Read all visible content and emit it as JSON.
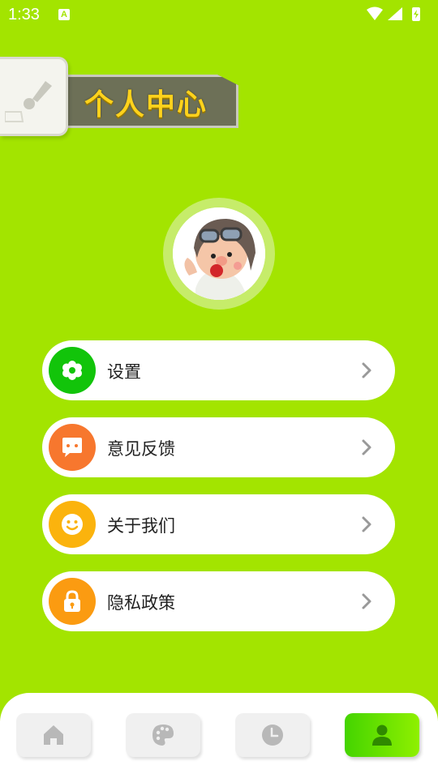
{
  "status_bar": {
    "time": "1:33",
    "notification_letter": "A"
  },
  "header": {
    "title": "个人中心"
  },
  "menu": {
    "items": [
      {
        "label": "设置",
        "icon": "gear-icon",
        "color": "#12c40a"
      },
      {
        "label": "意见反馈",
        "icon": "chat-bubble-icon",
        "color": "#f7772e"
      },
      {
        "label": "关于我们",
        "icon": "smile-icon",
        "color": "#fbb30d"
      },
      {
        "label": "隐私政策",
        "icon": "lock-icon",
        "color": "#fb9b11"
      }
    ]
  },
  "bottom_nav": {
    "items": [
      {
        "icon": "home-icon",
        "active": false
      },
      {
        "icon": "palette-icon",
        "active": false
      },
      {
        "icon": "clock-icon",
        "active": false
      },
      {
        "icon": "person-icon",
        "active": true
      }
    ]
  },
  "colors": {
    "background": "#a3e400",
    "banner_text": "#ffd21c",
    "nav_active": "#44d400"
  }
}
